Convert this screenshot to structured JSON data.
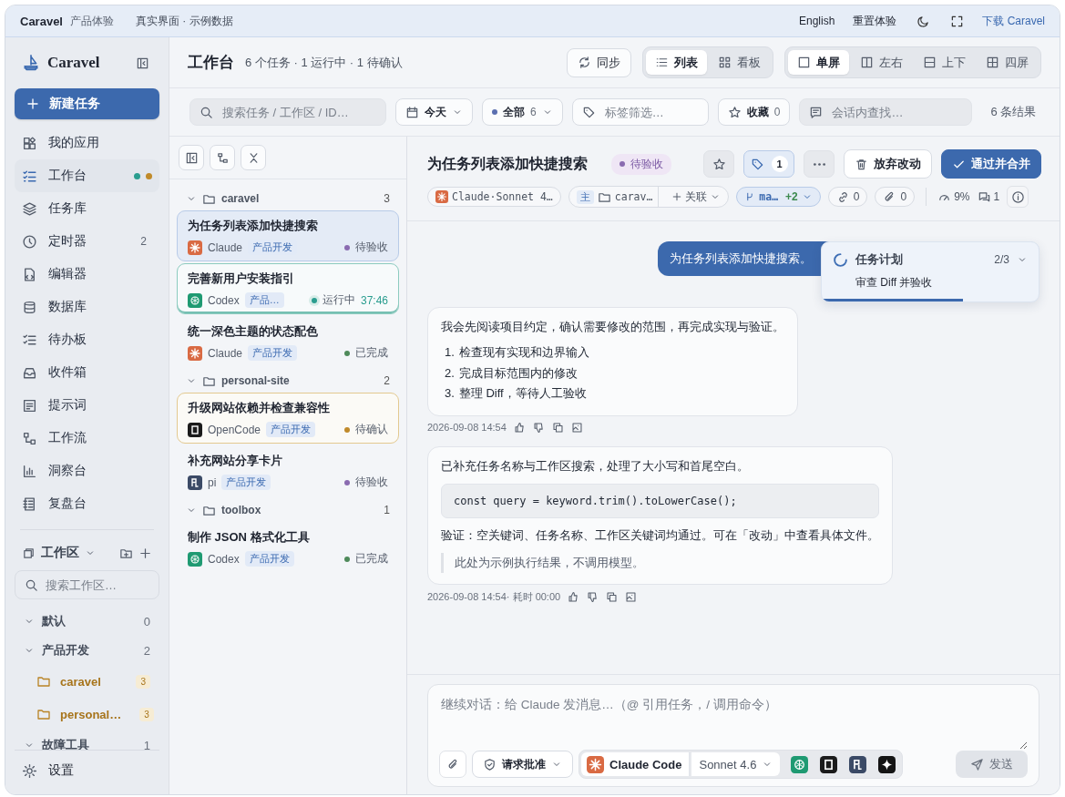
{
  "topbar": {
    "app_name": "Caravel",
    "app_tag": "产品体验",
    "subtitle": "真实界面 · 示例数据",
    "links": [
      "English",
      "重置体验"
    ],
    "download": "下载 Caravel"
  },
  "sidebar": {
    "brand": "Caravel",
    "new_task": "新建任务",
    "nav": [
      {
        "label": "我的应用",
        "selected": false
      },
      {
        "label": "工作台",
        "selected": true,
        "dots": [
          {
            "color": "#2a9d8f"
          },
          {
            "color": "#c08a2a"
          }
        ]
      },
      {
        "label": "任务库",
        "selected": false
      },
      {
        "label": "定时器",
        "selected": false,
        "count": "2"
      },
      {
        "label": "编辑器",
        "selected": false
      },
      {
        "label": "数据库",
        "selected": false
      },
      {
        "label": "待办板",
        "selected": false
      },
      {
        "label": "收件箱",
        "selected": false
      },
      {
        "label": "提示词",
        "selected": false
      },
      {
        "label": "工作流",
        "selected": false
      },
      {
        "label": "洞察台",
        "selected": false
      },
      {
        "label": "复盘台",
        "selected": false
      }
    ],
    "workspace": {
      "title": "工作区",
      "search_placeholder": "搜索工作区…",
      "groups": [
        {
          "label": "默认",
          "count": "0",
          "expanded": true
        },
        {
          "label": "产品开发",
          "count": "2",
          "expanded": true,
          "children": [
            {
              "label": "caravel",
              "count": "3"
            },
            {
              "label": "personal…",
              "count": "3"
            }
          ]
        },
        {
          "label": "故障工具",
          "count": "1",
          "expanded": true
        }
      ]
    },
    "settings": "设置"
  },
  "header": {
    "title": "工作台",
    "summary": "6 个任务 · 1 运行中 · 1 待确认",
    "sync": "同步",
    "view_modes": [
      {
        "label": "列表",
        "selected": true
      },
      {
        "label": "看板",
        "selected": false
      }
    ],
    "layouts": [
      {
        "label": "单屏",
        "selected": true
      },
      {
        "label": "左右",
        "selected": false
      },
      {
        "label": "上下",
        "selected": false
      },
      {
        "label": "四屏",
        "selected": false
      }
    ]
  },
  "filters": {
    "search_placeholder": "搜索任务 / 工作区 / ID…",
    "date": "今天",
    "status": {
      "label": "全部",
      "count": "6",
      "color": "#5b6fb0"
    },
    "tag_placeholder": "标签筛选…",
    "favorites": {
      "label": "收藏",
      "count": "0"
    },
    "chat_search_placeholder": "会话内查找…",
    "result_count": "6 条结果"
  },
  "task_groups": [
    {
      "name": "caravel",
      "count": "3",
      "expanded": true,
      "tasks": [
        {
          "title": "为任务列表添加快捷搜索",
          "agent": {
            "name": "Claude",
            "kind": "claude"
          },
          "tag": "产品开发",
          "status": "待验收",
          "color": "#8a6bb0",
          "selected": true,
          "kind": "plain"
        },
        {
          "title": "完善新用户安装指引",
          "agent": {
            "name": "Codex",
            "kind": "codex"
          },
          "tag": "产品…",
          "status": "运行中",
          "color": "#2a9d8f",
          "elapsed": "37:46",
          "selected": false,
          "kind": "running"
        },
        {
          "title": "统一深色主题的状态配色",
          "agent": {
            "name": "Claude",
            "kind": "claude"
          },
          "tag": "产品开发",
          "status": "已完成",
          "color": "#4e8a5a",
          "selected": false,
          "kind": "plain"
        }
      ]
    },
    {
      "name": "personal-site",
      "count": "2",
      "expanded": true,
      "tasks": [
        {
          "title": "升级网站依赖并检查兼容性",
          "agent": {
            "name": "OpenCode",
            "kind": "opencode"
          },
          "tag": "产品开发",
          "status": "待确认",
          "color": "#c08a2a",
          "selected": false,
          "kind": "confirm"
        },
        {
          "title": "补充网站分享卡片",
          "agent": {
            "name": "pi",
            "kind": "pi"
          },
          "tag": "产品开发",
          "status": "待验收",
          "color": "#8a6bb0",
          "selected": false,
          "kind": "plain"
        }
      ]
    },
    {
      "name": "toolbox",
      "count": "1",
      "expanded": true,
      "tasks": [
        {
          "title": "制作 JSON 格式化工具",
          "agent": {
            "name": "Codex",
            "kind": "codex"
          },
          "tag": "产品开发",
          "status": "已完成",
          "color": "#4e8a5a",
          "selected": false,
          "kind": "plain"
        }
      ]
    }
  ],
  "detail": {
    "title": "为任务列表添加快捷搜索",
    "status": "待验收",
    "color": "#8a6bb0",
    "favorite": false,
    "tag_count": "1",
    "discard": "放弃改动",
    "approve": "通过并合并",
    "meta": {
      "model": "Claude·Sonnet 4…",
      "branch_mark": "主",
      "workspace": "carav…",
      "link": "关联",
      "branch": "ma…",
      "branch_extra": "+2",
      "links_count": "0",
      "attachments_count": "0",
      "context": "9%",
      "comments": "1"
    }
  },
  "chat": {
    "messages": [
      {
        "kind": "user",
        "text": "为任务列表添加快捷搜索。"
      },
      {
        "kind": "assistant",
        "time": "2026-09-08 14:54",
        "blocks": [
          {
            "kind": "paragraph",
            "text": "我会先阅读项目约定，确认需要修改的范围，再完成实现与验证。"
          },
          {
            "kind": "list",
            "items": [
              {
                "number": "1.",
                "text": "检查现有实现和边界输入"
              },
              {
                "number": "2.",
                "text": "完成目标范围内的修改"
              },
              {
                "number": "3.",
                "text": "整理 Diff，等待人工验收"
              }
            ]
          }
        ]
      },
      {
        "kind": "assistant",
        "time": "2026-09-08 14:54· 耗时 00:00",
        "blocks": [
          {
            "kind": "paragraph",
            "text": "已补充任务名称与工作区搜索，处理了大小写和首尾空白。"
          },
          {
            "kind": "code",
            "text": "const query = keyword.trim().toLowerCase();"
          },
          {
            "kind": "paragraph",
            "text": "验证：空关键词、任务名称、工作区关键词均通过。可在「改动」中查看具体文件。"
          },
          {
            "kind": "quote",
            "text": "此处为示例执行结果，不调用模型。"
          }
        ]
      }
    ],
    "plan": {
      "title": "任务计划",
      "progress": "2/3",
      "step": "审查 Diff 并验收",
      "level": 0.65
    }
  },
  "composer": {
    "placeholder": "继续对话：给 Claude 发消息…（@ 引用任务，/ 调用命令）",
    "approval": "请求批准",
    "agent": "Claude Code",
    "model": "Sonnet 4.6",
    "send": "发送",
    "send_disabled": true
  }
}
